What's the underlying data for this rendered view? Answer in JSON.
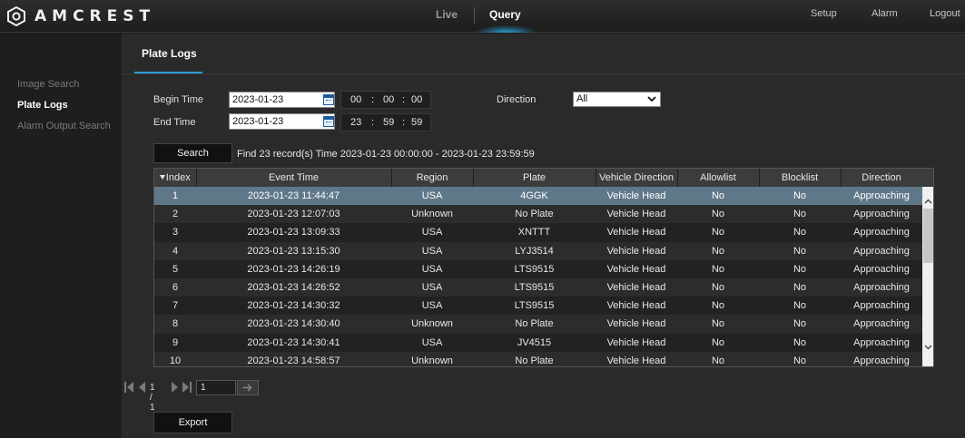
{
  "brand": {
    "name": "AMCREST"
  },
  "nav": {
    "live": "Live",
    "query": "Query",
    "setup": "Setup",
    "alarm": "Alarm",
    "logout": "Logout"
  },
  "sidebar": {
    "items": [
      {
        "label": "Image Search"
      },
      {
        "label": "Plate Logs"
      },
      {
        "label": "Alarm Output Search"
      }
    ],
    "active": "Plate Logs"
  },
  "page": {
    "title": "Plate Logs"
  },
  "form": {
    "begin_label": "Begin Time",
    "end_label": "End Time",
    "begin_date": "2023-01-23",
    "end_date": "2023-01-23",
    "begin_time": {
      "h": "00",
      "m": "00",
      "s": "00"
    },
    "end_time": {
      "h": "23",
      "m": "59",
      "s": "59"
    },
    "time_sep": ":",
    "direction_label": "Direction",
    "direction_value": "All",
    "search_button": "Search",
    "result_text": "Find 23 record(s) Time 2023-01-23 00:00:00 - 2023-01-23 23:59:59"
  },
  "table": {
    "headers": [
      "Index",
      "Event Time",
      "Region",
      "Plate",
      "Vehicle Direction",
      "Allowlist",
      "Blocklist",
      "Direction"
    ],
    "rows": [
      [
        "1",
        "2023-01-23 11:44:47",
        "USA",
        "4GGK",
        "Vehicle Head",
        "No",
        "No",
        "Approaching"
      ],
      [
        "2",
        "2023-01-23 12:07:03",
        "Unknown",
        "No Plate",
        "Vehicle Head",
        "No",
        "No",
        "Approaching"
      ],
      [
        "3",
        "2023-01-23 13:09:33",
        "USA",
        "XNTTT",
        "Vehicle Head",
        "No",
        "No",
        "Approaching"
      ],
      [
        "4",
        "2023-01-23 13:15:30",
        "USA",
        "LYJ3514",
        "Vehicle Head",
        "No",
        "No",
        "Approaching"
      ],
      [
        "5",
        "2023-01-23 14:26:19",
        "USA",
        "LTS9515",
        "Vehicle Head",
        "No",
        "No",
        "Approaching"
      ],
      [
        "6",
        "2023-01-23 14:26:52",
        "USA",
        "LTS9515",
        "Vehicle Head",
        "No",
        "No",
        "Approaching"
      ],
      [
        "7",
        "2023-01-23 14:30:32",
        "USA",
        "LTS9515",
        "Vehicle Head",
        "No",
        "No",
        "Approaching"
      ],
      [
        "8",
        "2023-01-23 14:30:40",
        "Unknown",
        "No Plate",
        "Vehicle Head",
        "No",
        "No",
        "Approaching"
      ],
      [
        "9",
        "2023-01-23 14:30:41",
        "USA",
        "JV4515",
        "Vehicle Head",
        "No",
        "No",
        "Approaching"
      ],
      [
        "10",
        "2023-01-23 14:58:57",
        "Unknown",
        "No Plate",
        "Vehicle Head",
        "No",
        "No",
        "Approaching"
      ]
    ],
    "selected_row": 1
  },
  "pager": {
    "page_text": "1 / 1",
    "page_input": "1"
  },
  "export_button": "Export",
  "colors": {
    "accent": "#2a9ed8",
    "selected_row": "#5f7889"
  }
}
